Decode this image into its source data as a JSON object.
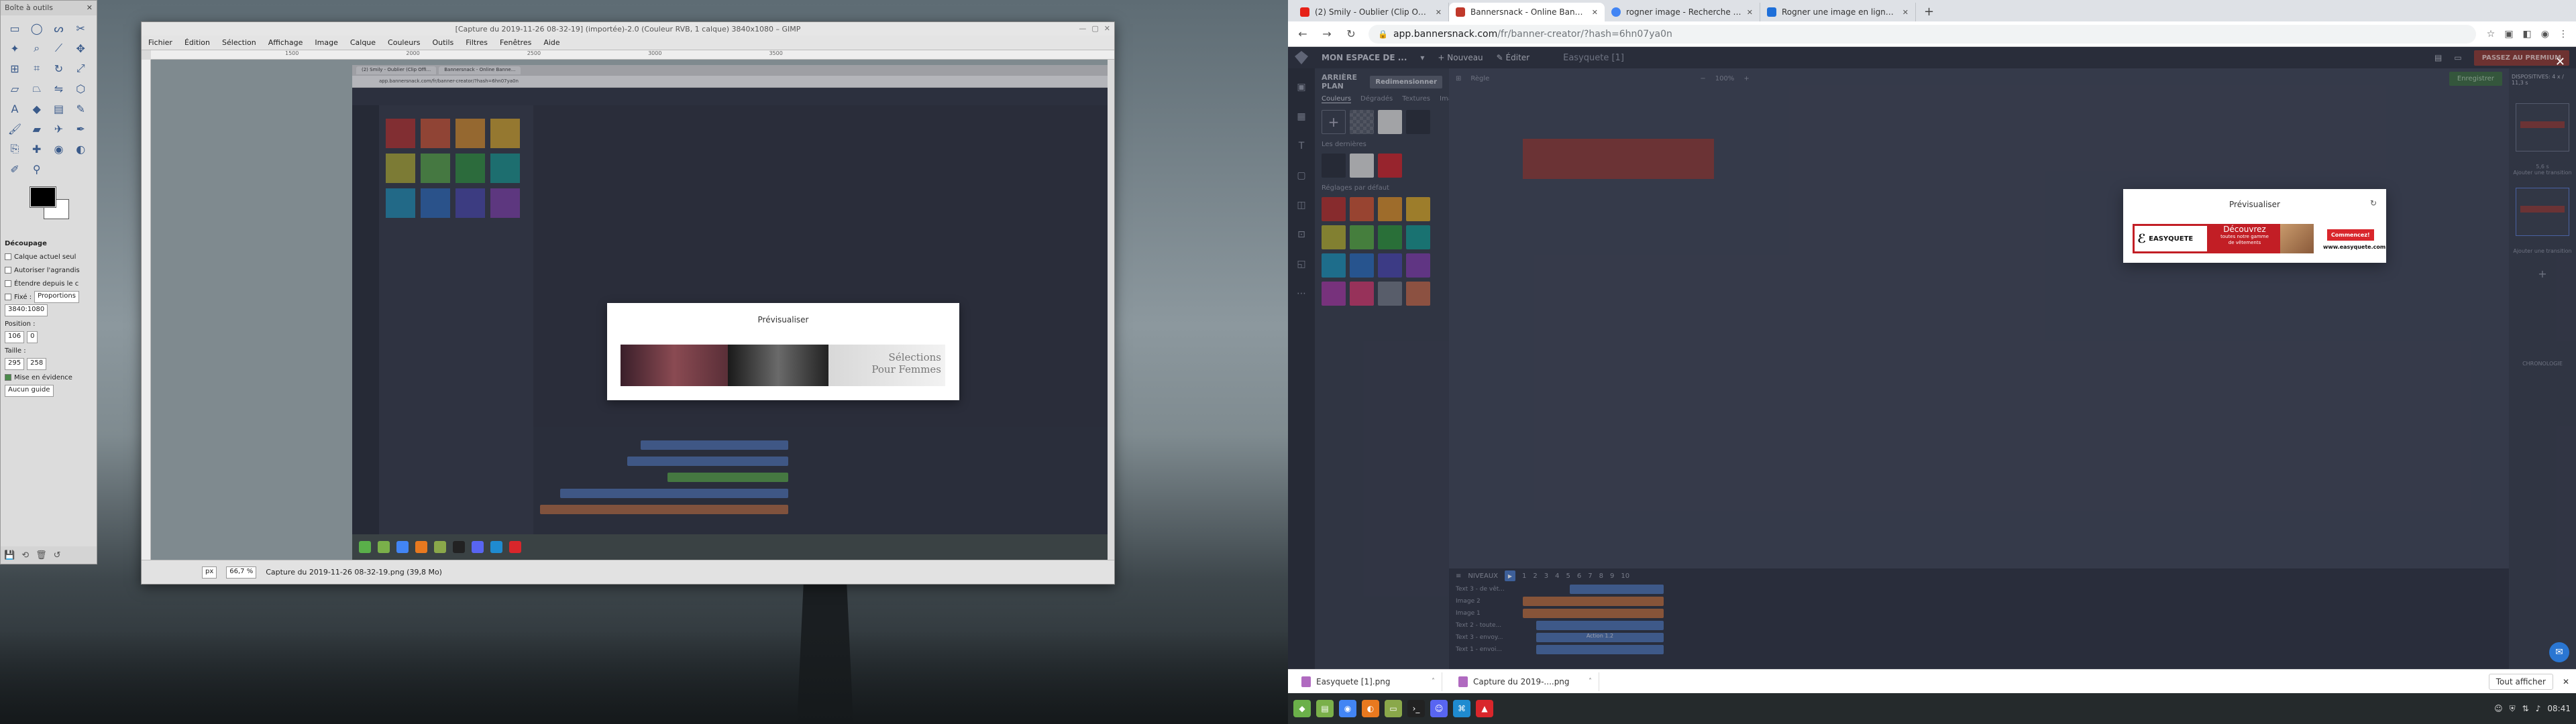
{
  "gimp_toolbox": {
    "title": "Boîte à outils",
    "tool_options_title": "Découpage",
    "opt_current_layer": "Calque actuel seul",
    "opt_enlarge": "Autoriser l'agrandis",
    "opt_expand_center": "Étendre depuis le c",
    "opt_fixed": "Fixé :",
    "opt_fixed_mode": "Proportions",
    "ratio_value": "3840:1080",
    "position_label": "Position :",
    "position_x": "106",
    "position_y": "0",
    "size_label": "Taille :",
    "size_w": "295",
    "size_h": "258",
    "highlight_label": "Mise en évidence",
    "guides_value": "Aucun guide"
  },
  "gimp_window": {
    "title": "[Capture du 2019-11-26 08-32-19] (importée)-2.0 (Couleur RVB, 1 calque) 3840x1080 – GIMP",
    "menus": [
      "Fichier",
      "Édition",
      "Sélection",
      "Affichage",
      "Image",
      "Calque",
      "Couleurs",
      "Outils",
      "Filtres",
      "Fenêtres",
      "Aide"
    ],
    "ruler_ticks": [
      "1500",
      "2000",
      "2500",
      "3000",
      "3500"
    ],
    "unit": "px",
    "zoom": "66,7 %",
    "status_text": "Capture du 2019-11-26 08-32-19.png (39,8 Mo)"
  },
  "mini_shot": {
    "tab1": "(2) Smily - Oublier (Clip Offi...",
    "tab2": "Bannersnack - Online Banne...",
    "url": "app.bannersnack.com/fr/banner-creator/?hash=6hn07ya0n",
    "modal_title": "Prévisualiser",
    "banner_text_line1": "Sélections",
    "banner_text_line2": "Pour Femmes"
  },
  "chrome": {
    "tabs": [
      {
        "label": "(2) Smily - Oublier (Clip Offi...",
        "fav_color": "#e62117"
      },
      {
        "label": "Bannersnack - Online Banner...",
        "fav_color": "#c0392b"
      },
      {
        "label": "rogner image - Recherche Goo...",
        "fav_color": "#4285f4"
      },
      {
        "label": "Rogner une image en ligne et ...",
        "fav_color": "#1e6fd9"
      }
    ],
    "url_host": "app.bannersnack.com",
    "url_path": "/fr/banner-creator/?hash=6hn07ya0n"
  },
  "app": {
    "workspace": "MON ESPACE DE ...",
    "new_label": "Nouveau",
    "edit_label": "Éditer",
    "doc_title": "Easyquete [1]",
    "upgrade_label": "PASSEZ AU PREMIUM",
    "panel_title": "ARRIÈRE PLAN",
    "redim_label": "Redimensionner",
    "panel_tabs": [
      "Couleurs",
      "Dégradés",
      "Textures",
      "Images"
    ],
    "recent_label": "Les dernières",
    "default_label": "Réglages par défaut",
    "canvas_rule_label": "Règle",
    "zoom_value": "100%",
    "save_label": "Enregistrer",
    "slides_title": "DISPOSITIVES: 4 x / 11,3 s",
    "slide_duration": "5,6 s",
    "add_transition_label": "Ajouter une transition",
    "timeline_title": "NIVEAUX",
    "timeline_ticks": [
      "1",
      "2",
      "3",
      "4",
      "5",
      "6",
      "7",
      "8",
      "9",
      "10"
    ],
    "layers": [
      "Text 3 - de vêt...",
      "Image 2",
      "Image 1",
      "Text 2 - toute...",
      "Text 3 - envoy...",
      "Text 1 - envoi..."
    ],
    "timeline_label_in_bar": "Action 1.2",
    "chronology_label": "CHRONOLOGIE"
  },
  "preview_modal": {
    "title": "Prévisualiser",
    "logo_text": "EASYQUETE",
    "headline": "Découvrez",
    "subline1": "toutes notre gamme",
    "subline2": "de vêtements",
    "cta_label": "Commencez!",
    "site": "www.easyquete.com"
  },
  "downloads": {
    "items": [
      "Easyquete [1].png",
      "Capture du 2019-....png"
    ],
    "show_all": "Tout afficher"
  },
  "taskbar": {
    "clock": "08:41"
  },
  "colors": {
    "swatches_recent": [
      "#2a2e3b",
      "#d6d6d6",
      "#c6262f"
    ],
    "swatches_default": [
      "#b1302e",
      "#c85234",
      "#d0892c",
      "#cfa12b",
      "#a9a634",
      "#55a245",
      "#2f8e3e",
      "#18928d",
      "#1f8bb1",
      "#2b68b5",
      "#4846a8",
      "#7a3ea5",
      "#9a3a9b",
      "#c63a6d",
      "#6f7583",
      "#b8644a"
    ]
  }
}
